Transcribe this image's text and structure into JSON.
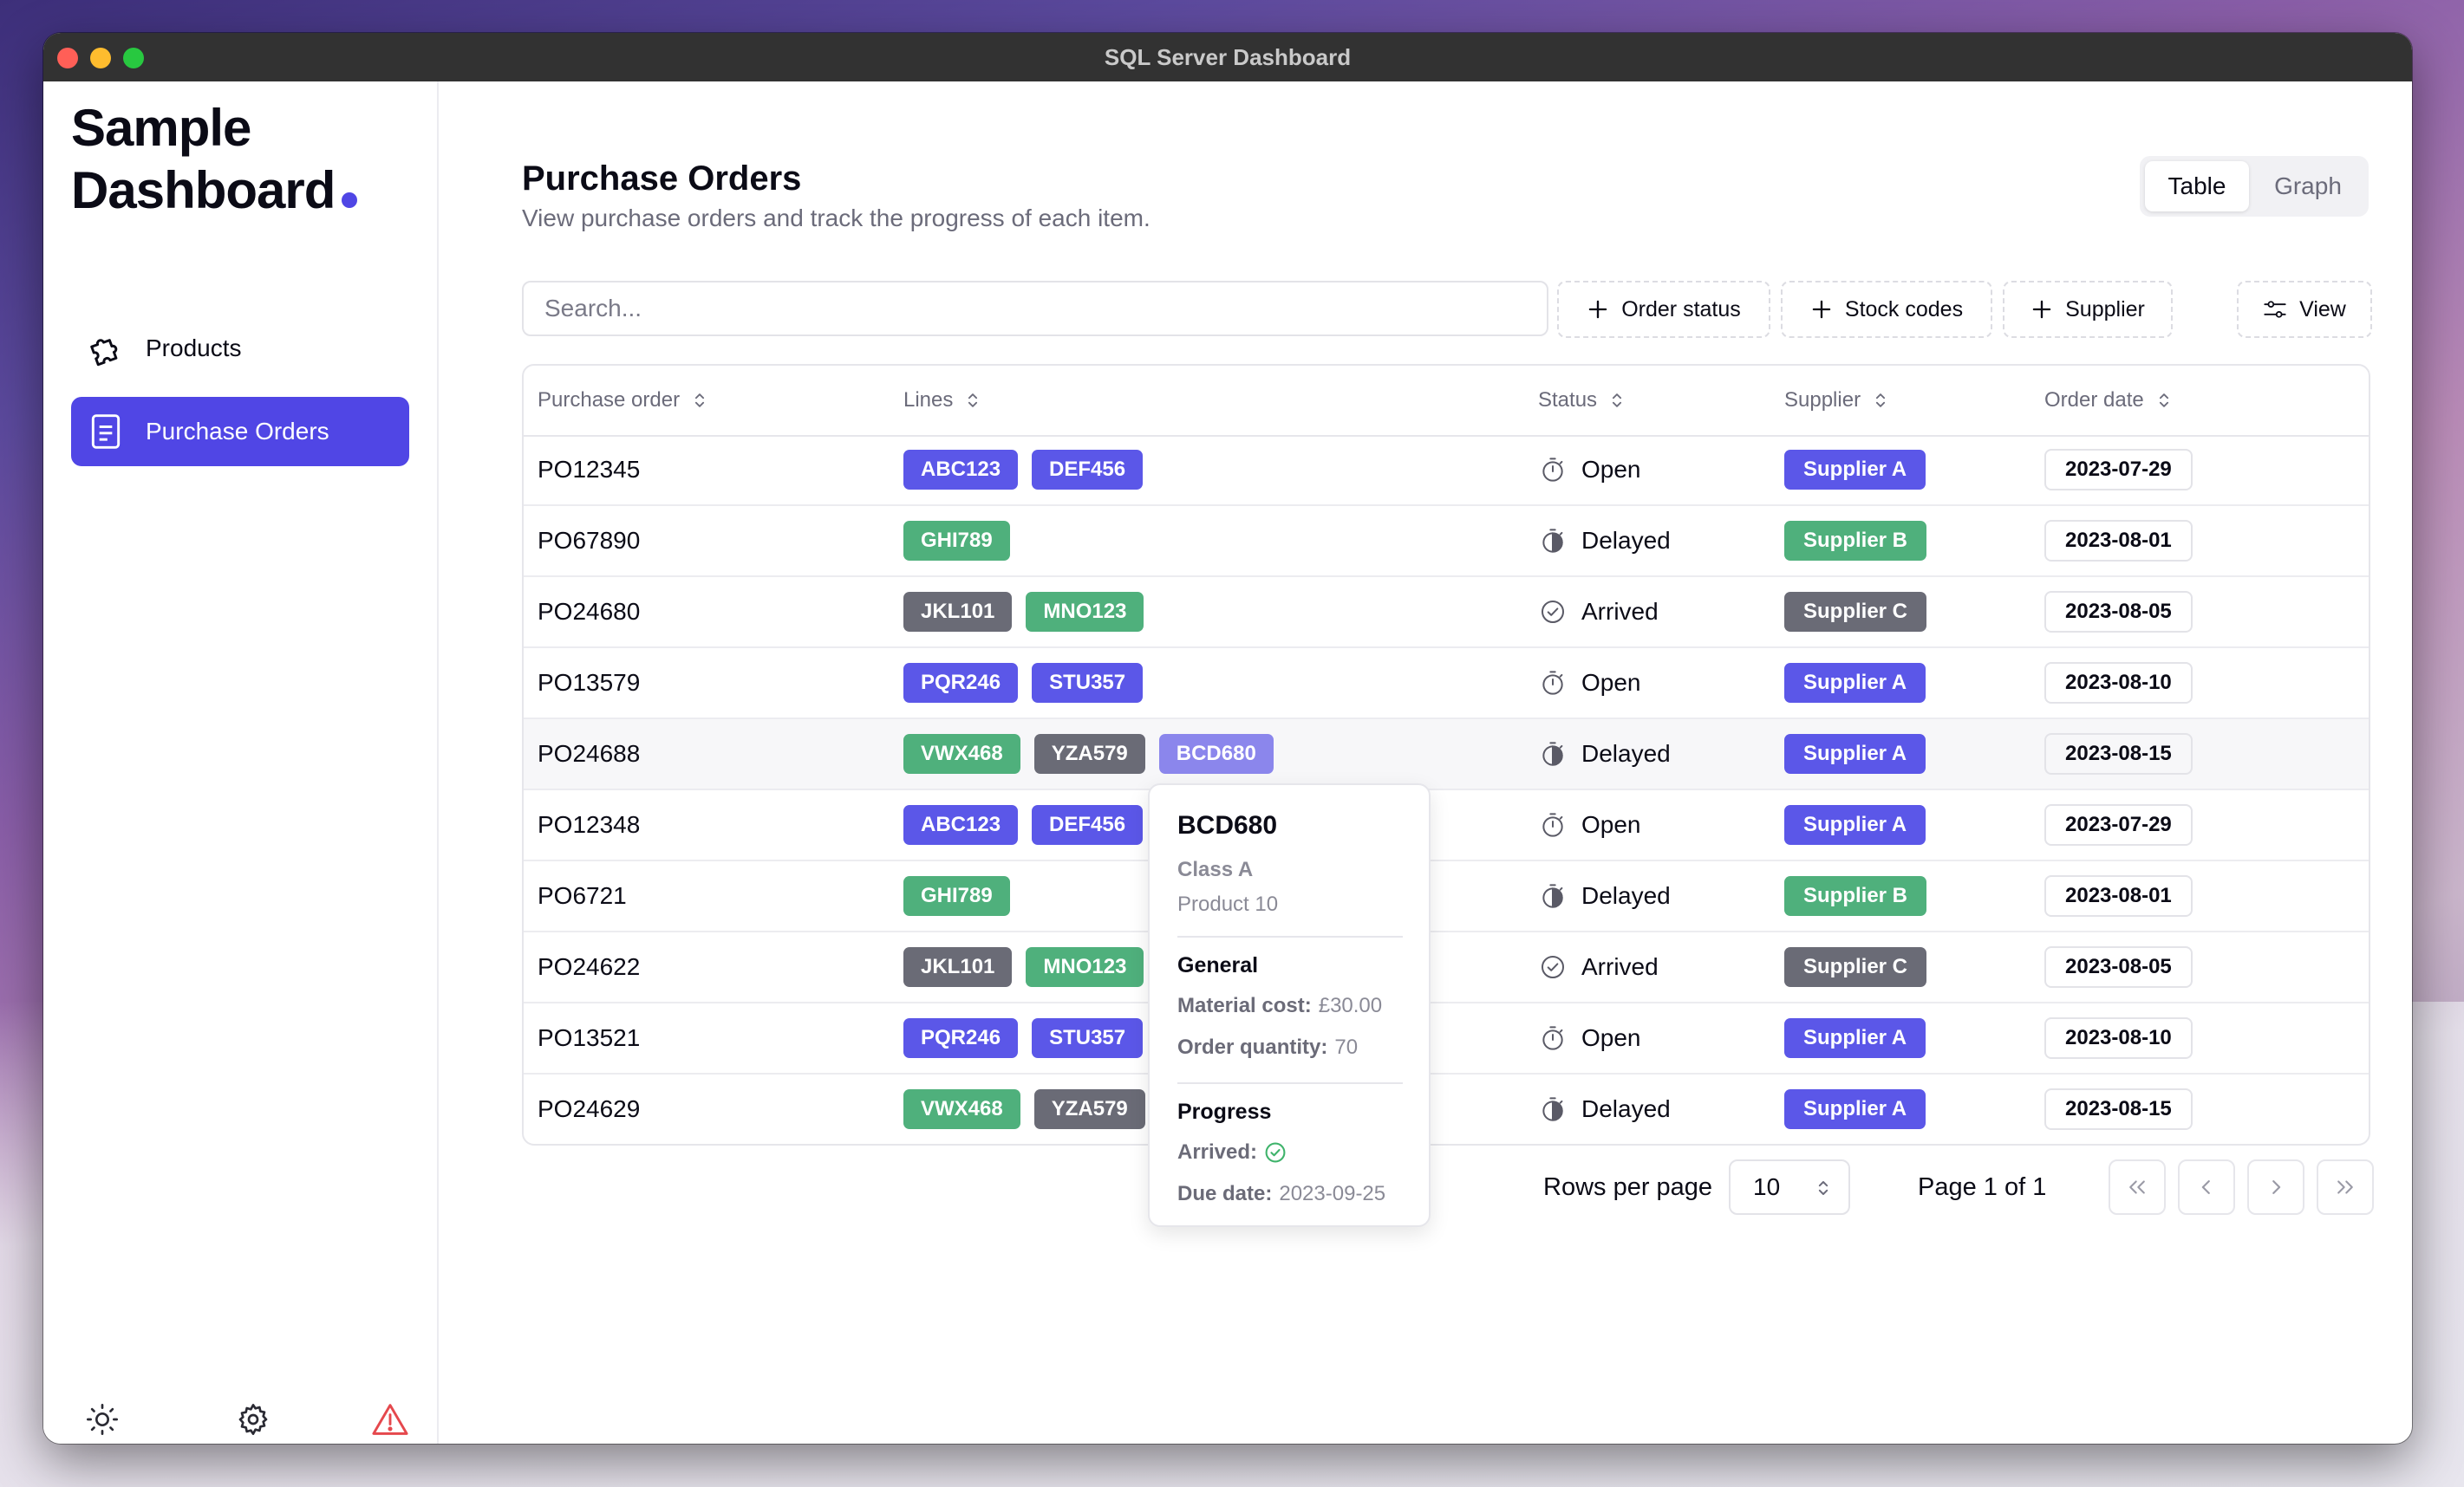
{
  "window": {
    "title": "SQL Server Dashboard"
  },
  "sidebar": {
    "brand_line1": "Sample",
    "brand_line2": "Dashboard",
    "brand_dot_color": "#4f46e5",
    "items": [
      {
        "label": "Products",
        "icon": "puzzle-icon",
        "active": false
      },
      {
        "label": "Purchase Orders",
        "icon": "document-icon",
        "active": true
      }
    ],
    "bottom_icons": [
      "sun-icon",
      "gear-icon",
      "warning-icon"
    ]
  },
  "header": {
    "title": "Purchase Orders",
    "subtitle": "View purchase orders and track the progress of each item.",
    "view_toggle": {
      "options": [
        "Table",
        "Graph"
      ],
      "selected": "Table"
    }
  },
  "toolbar": {
    "search_placeholder": "Search...",
    "filters": [
      "Order status",
      "Stock codes",
      "Supplier"
    ],
    "view_label": "View"
  },
  "table": {
    "columns": [
      "Purchase order",
      "Lines",
      "Status",
      "Supplier",
      "Order date"
    ],
    "rows": [
      {
        "po": "PO12345",
        "lines": [
          {
            "code": "ABC123",
            "color": "indigo"
          },
          {
            "code": "DEF456",
            "color": "indigo"
          }
        ],
        "status": "Open",
        "supplier": "Supplier A",
        "supplier_color": "indigo",
        "date": "2023-07-29"
      },
      {
        "po": "PO67890",
        "lines": [
          {
            "code": "GHI789",
            "color": "green"
          }
        ],
        "status": "Delayed",
        "supplier": "Supplier B",
        "supplier_color": "green",
        "date": "2023-08-01"
      },
      {
        "po": "PO24680",
        "lines": [
          {
            "code": "JKL101",
            "color": "gray"
          },
          {
            "code": "MNO123",
            "color": "green"
          }
        ],
        "status": "Arrived",
        "supplier": "Supplier C",
        "supplier_color": "gray",
        "date": "2023-08-05"
      },
      {
        "po": "PO13579",
        "lines": [
          {
            "code": "PQR246",
            "color": "indigo"
          },
          {
            "code": "STU357",
            "color": "indigo"
          }
        ],
        "status": "Open",
        "supplier": "Supplier A",
        "supplier_color": "indigo",
        "date": "2023-08-10"
      },
      {
        "po": "PO24688",
        "lines": [
          {
            "code": "VWX468",
            "color": "green"
          },
          {
            "code": "YZA579",
            "color": "gray"
          },
          {
            "code": "BCD680",
            "color": "light"
          }
        ],
        "status": "Delayed",
        "supplier": "Supplier A",
        "supplier_color": "indigo",
        "date": "2023-08-15",
        "highlight": true
      },
      {
        "po": "PO12348",
        "lines": [
          {
            "code": "ABC123",
            "color": "indigo"
          },
          {
            "code": "DEF456",
            "color": "indigo"
          }
        ],
        "status": "Open",
        "supplier": "Supplier A",
        "supplier_color": "indigo",
        "date": "2023-07-29"
      },
      {
        "po": "PO6721",
        "lines": [
          {
            "code": "GHI789",
            "color": "green"
          }
        ],
        "status": "Delayed",
        "supplier": "Supplier B",
        "supplier_color": "green",
        "date": "2023-08-01"
      },
      {
        "po": "PO24622",
        "lines": [
          {
            "code": "JKL101",
            "color": "gray"
          },
          {
            "code": "MNO123",
            "color": "green"
          }
        ],
        "status": "Arrived",
        "supplier": "Supplier C",
        "supplier_color": "gray",
        "date": "2023-08-05"
      },
      {
        "po": "PO13521",
        "lines": [
          {
            "code": "PQR246",
            "color": "indigo"
          },
          {
            "code": "STU357",
            "color": "indigo"
          }
        ],
        "status": "Open",
        "supplier": "Supplier A",
        "supplier_color": "indigo",
        "date": "2023-08-10"
      },
      {
        "po": "PO24629",
        "lines": [
          {
            "code": "VWX468",
            "color": "green"
          },
          {
            "code": "YZA579",
            "color": "gray"
          }
        ],
        "status": "Delayed",
        "supplier": "Supplier A",
        "supplier_color": "indigo",
        "date": "2023-08-15"
      }
    ]
  },
  "popover": {
    "code": "BCD680",
    "class": "Class A",
    "product": "Product 10",
    "general_heading": "General",
    "material_cost_label": "Material cost:",
    "material_cost": "£30.00",
    "order_quantity_label": "Order quantity:",
    "order_quantity": "70",
    "progress_heading": "Progress",
    "arrived_label": "Arrived:",
    "due_date_label": "Due date:",
    "due_date": "2023-09-25"
  },
  "pagination": {
    "rows_per_page_label": "Rows per page",
    "rows_per_page": "10",
    "page_label": "Page 1 of 1"
  },
  "colors": {
    "accent": "#5046e5",
    "indigo_chip": "#5b57e8",
    "green_chip": "#4fb07c",
    "gray_chip": "#6a6b76",
    "light_chip": "#8b86ec"
  }
}
